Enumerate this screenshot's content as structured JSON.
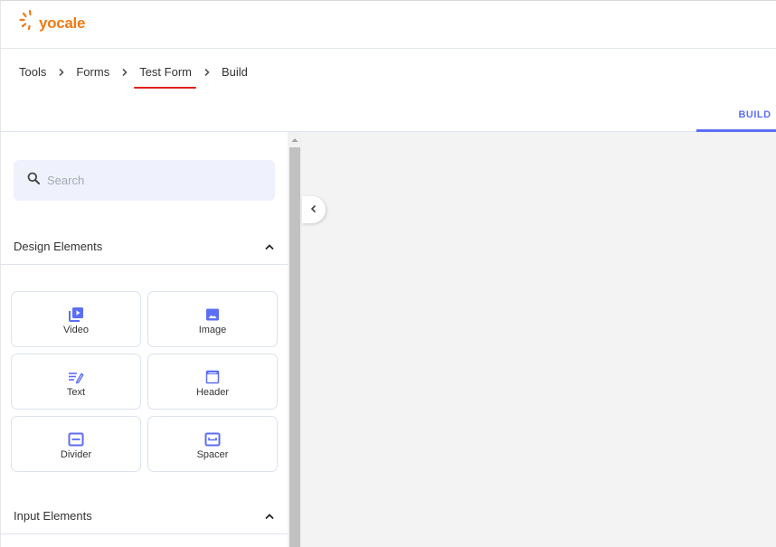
{
  "header": {
    "logo_text": "yocale",
    "brand_color": "#f07a12"
  },
  "breadcrumb": [
    {
      "label": "Tools"
    },
    {
      "label": "Forms"
    },
    {
      "label": "Test Form"
    },
    {
      "label": "Build"
    }
  ],
  "tabs": [
    {
      "label": "BUILD",
      "active": true
    }
  ],
  "sidebar": {
    "search": {
      "placeholder": "Search",
      "value": "",
      "icon": "search-icon"
    },
    "sections": [
      {
        "title": "Design Elements",
        "expanded": true,
        "items": [
          {
            "label": "Video",
            "icon": "video-library-icon"
          },
          {
            "label": "Image",
            "icon": "image-icon"
          },
          {
            "label": "Text",
            "icon": "text-edit-icon"
          },
          {
            "label": "Header",
            "icon": "header-window-icon"
          },
          {
            "label": "Divider",
            "icon": "divider-icon"
          },
          {
            "label": "Spacer",
            "icon": "spacer-icon"
          }
        ]
      },
      {
        "title": "Input Elements",
        "expanded": true,
        "items": []
      }
    ]
  },
  "colors": {
    "accent": "#5b6ef5",
    "highlight_underline": "#e0201c",
    "canvas_bg": "#f3f3f3"
  }
}
